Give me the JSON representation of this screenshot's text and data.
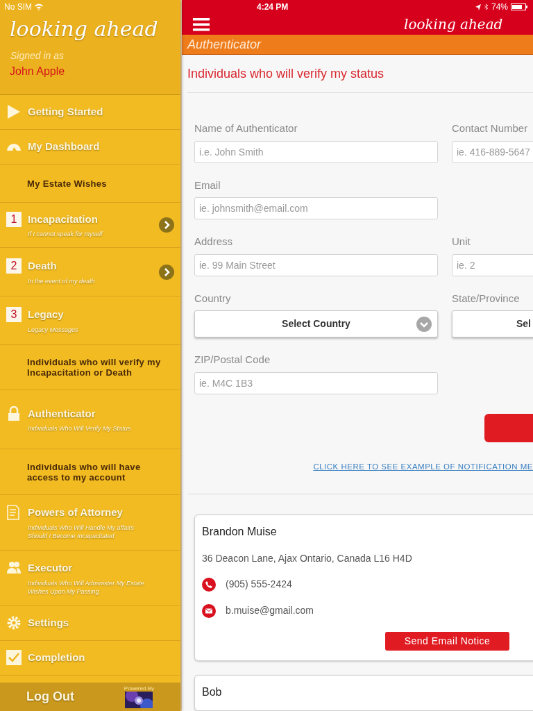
{
  "status_bar": {
    "carrier": "No SIM",
    "time": "4:24 PM",
    "battery": "74%"
  },
  "sidebar": {
    "logo": "looking ahead",
    "signed_in_label": "Signed in as",
    "user_name": "John Apple",
    "items": [
      {
        "kind": "link",
        "title": "Getting Started"
      },
      {
        "kind": "link",
        "title": "My Dashboard"
      },
      {
        "kind": "heading",
        "title": "My Estate Wishes"
      },
      {
        "kind": "numbered",
        "number": "1",
        "title": "Incapacitation",
        "subtitle": "If I cannot speak for myself",
        "arrow": true
      },
      {
        "kind": "numbered",
        "number": "2",
        "title": "Death",
        "subtitle": "In the event of my death",
        "arrow": true
      },
      {
        "kind": "numbered",
        "number": "3",
        "title": "Legacy",
        "subtitle": "Legacy Messages",
        "arrow": false
      },
      {
        "kind": "heading",
        "title": "Individuals who will verify my Incapacitation or Death"
      },
      {
        "kind": "link",
        "title": "Authenticator",
        "subtitle": "Individuals Who Will Verify My Status"
      },
      {
        "kind": "heading",
        "title": "Individuals who will have access to my account"
      },
      {
        "kind": "link",
        "title": "Powers of Attorney",
        "subtitle": "Individuals Who Will Handle My affairs Should I Become Incapacitated"
      },
      {
        "kind": "link",
        "title": "Executor",
        "subtitle": "Individuals Who Will Administer My Estate Wishes Upon My Passing"
      },
      {
        "kind": "link",
        "title": "Settings"
      },
      {
        "kind": "link",
        "title": "Completion"
      }
    ],
    "logout": "Log Out",
    "powered_by": "Powered By"
  },
  "header": {
    "logo": "looking ahead"
  },
  "section_bar": {
    "title": "Authenticator"
  },
  "page": {
    "heading": "Individuals who will verify my status",
    "form_rows": [
      [
        {
          "kind": "text",
          "label": "Name of Authenticator",
          "placeholder": "i.e. John Smith"
        },
        {
          "kind": "text",
          "label": "Contact Number",
          "placeholder": "ie. 416-889-5647"
        }
      ],
      [
        {
          "kind": "text",
          "label": "Email",
          "placeholder": "ie. johnsmith@email.com"
        }
      ],
      [
        {
          "kind": "text",
          "label": "Address",
          "placeholder": "ie. 99 Main Street"
        },
        {
          "kind": "text",
          "label": "Unit",
          "placeholder": "ie. 2"
        }
      ],
      [
        {
          "kind": "select",
          "label": "Country",
          "value": "Select Country"
        },
        {
          "kind": "select",
          "label": "State/Province",
          "value": "Sel"
        }
      ],
      [
        {
          "kind": "text",
          "label": "ZIP/Postal Code",
          "placeholder": "ie. M4C 1B3"
        }
      ]
    ],
    "link": "CLICK HERE TO SEE EXAMPLE OF NOTIFICATION ME",
    "contacts": [
      {
        "name": "Brandon Muise",
        "address": "36 Deacon Lane, Ajax Ontario, Canada L16 H4D",
        "phone": "(905) 555-2424",
        "email": "b.muise@gmail.com",
        "button": "Send Email Notice"
      },
      {
        "name": "Bob"
      }
    ]
  }
}
